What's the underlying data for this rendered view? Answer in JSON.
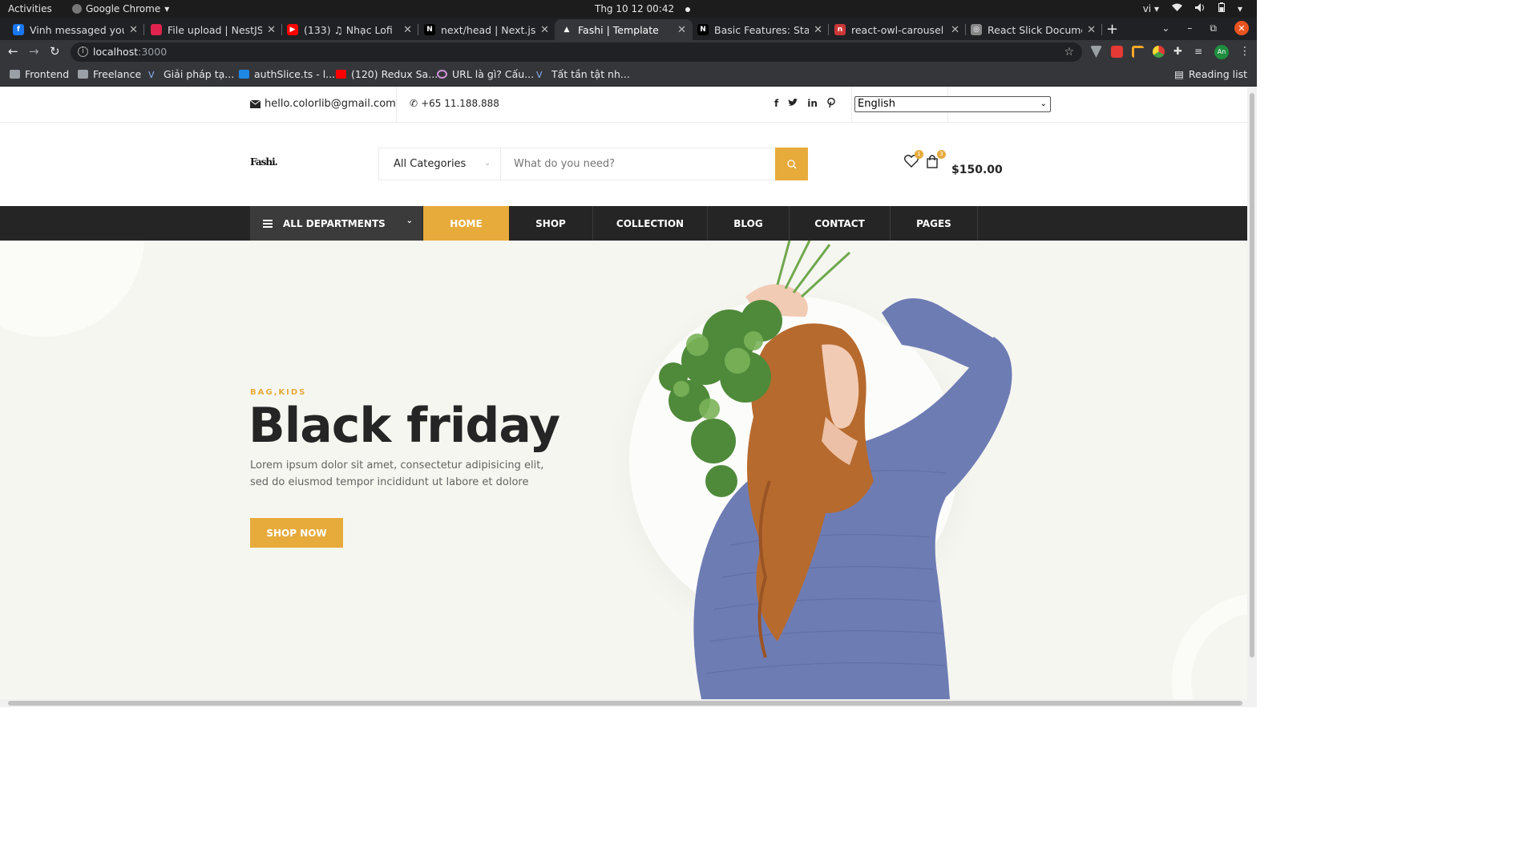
{
  "os_bar": {
    "activities": "Activities",
    "app_name": "Google Chrome",
    "clock": "Thg 10 12  00:42",
    "lang": "vi"
  },
  "tabs": [
    {
      "title": "Vinh messaged you",
      "color": "#1877f2",
      "glyph": "f"
    },
    {
      "title": "File upload | NestJS -",
      "color": "#e0234e",
      "glyph": ""
    },
    {
      "title": "(133) ♫ Nhạc Lofi",
      "color": "#ff0000",
      "glyph": "▶"
    },
    {
      "title": "next/head | Next.js",
      "color": "#000000",
      "glyph": "N"
    },
    {
      "title": "Fashi | Template",
      "color": "#000000",
      "glyph": "▲"
    },
    {
      "title": "Basic Features: Static",
      "color": "#000000",
      "glyph": "N"
    },
    {
      "title": "react-owl-carousel - n",
      "color": "#cb3837",
      "glyph": "n"
    },
    {
      "title": "React Slick Documen",
      "color": "#888888",
      "glyph": "◎"
    }
  ],
  "address": {
    "host": "localhost",
    "port": ":3000"
  },
  "bookmarks": [
    {
      "label": "Frontend",
      "type": "folder"
    },
    {
      "label": "Freelance",
      "type": "folder"
    },
    {
      "label": "Giải pháp tạ...",
      "type": "v"
    },
    {
      "label": "authSlice.ts - l...",
      "type": "vs"
    },
    {
      "label": "(120) Redux Sa...",
      "type": "yt"
    },
    {
      "label": "URL là gì? Cấu...",
      "type": "web"
    },
    {
      "label": "Tất tần tật nh...",
      "type": "v"
    }
  ],
  "reading_list": "Reading list",
  "header_top": {
    "email": "hello.colorlib@gmail.com",
    "phone": "+65 11.188.888",
    "social": [
      "f",
      "t",
      "in",
      "p"
    ],
    "language": "English"
  },
  "header": {
    "logo": "Fashi.",
    "search_category": "All Categories",
    "search_placeholder": "What do you need?",
    "wishlist_count": "1",
    "cart_count": "3",
    "cart_total": "$150.00"
  },
  "nav": {
    "departments": "ALL DEPARTMENTS",
    "items": [
      "HOME",
      "SHOP",
      "COLLECTION",
      "BLOG",
      "CONTACT",
      "PAGES"
    ]
  },
  "hero": {
    "tag": "BAG,KIDS",
    "title": "Black friday",
    "description": "Lorem ipsum dolor sit amet, consectetur adipisicing elit, sed do eiusmod tempor incididunt ut labore et dolore",
    "cta": "SHOP NOW"
  },
  "colors": {
    "accent": "#e7ab3c",
    "dark": "#252525",
    "hero_bg": "#f6f6f1"
  }
}
